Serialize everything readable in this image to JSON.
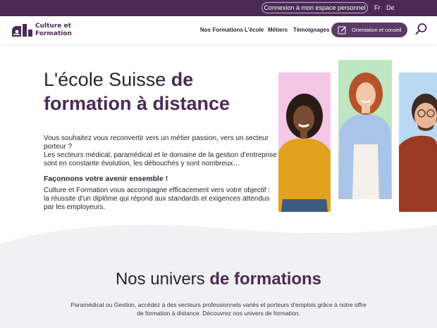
{
  "topbar": {
    "account_label": "Connexion à mon espace personnel",
    "languages": [
      "Fr",
      "De"
    ]
  },
  "header": {
    "logo_lines": [
      "Culture et",
      "Formation"
    ],
    "nav": [
      "Nos Formations",
      "L'école",
      "Métiers",
      "Témoignages"
    ],
    "cta_label": "Orientation et conseil",
    "icons": {
      "cta": "edit-icon",
      "search": "search-icon"
    }
  },
  "hero": {
    "title_regular": "L'école Suisse ",
    "title_strong": "de formation à distance",
    "paragraph_1": "Vous souhaitez vous reconvertir vers un métier passion, vers un secteur porteur ?",
    "paragraph_2": "Les secteurs médical, paramédical et le domaine de la gestion d'entreprise sont en constante évolution, les débouchés y sont nombreux…",
    "slogan": "Façonnons votre avenir ensemble !",
    "paragraph_3": "Culture et Formation vous accompagne efficacement vers votre objectif :",
    "paragraph_4": "la réussite d'un diplôme qui répond aux standards et exigences attendus par les employeurs."
  },
  "section": {
    "title_regular": "Nos univers ",
    "title_strong": "de formations",
    "subtitle": "Paramédical ou Gestion, accédez à des secteurs professionnels variés et porteurs d'emplois grâce à notre offre de formation à distance. Découvrez nos univers de formation."
  },
  "colors": {
    "brand_purple": "#4b2a55",
    "cta_purple": "#5b3a66",
    "photo_pink": "#f5c6e6",
    "photo_green": "#bde6c1",
    "photo_blue": "#b9d9f3",
    "wave_gray": "#f1f1f3"
  }
}
